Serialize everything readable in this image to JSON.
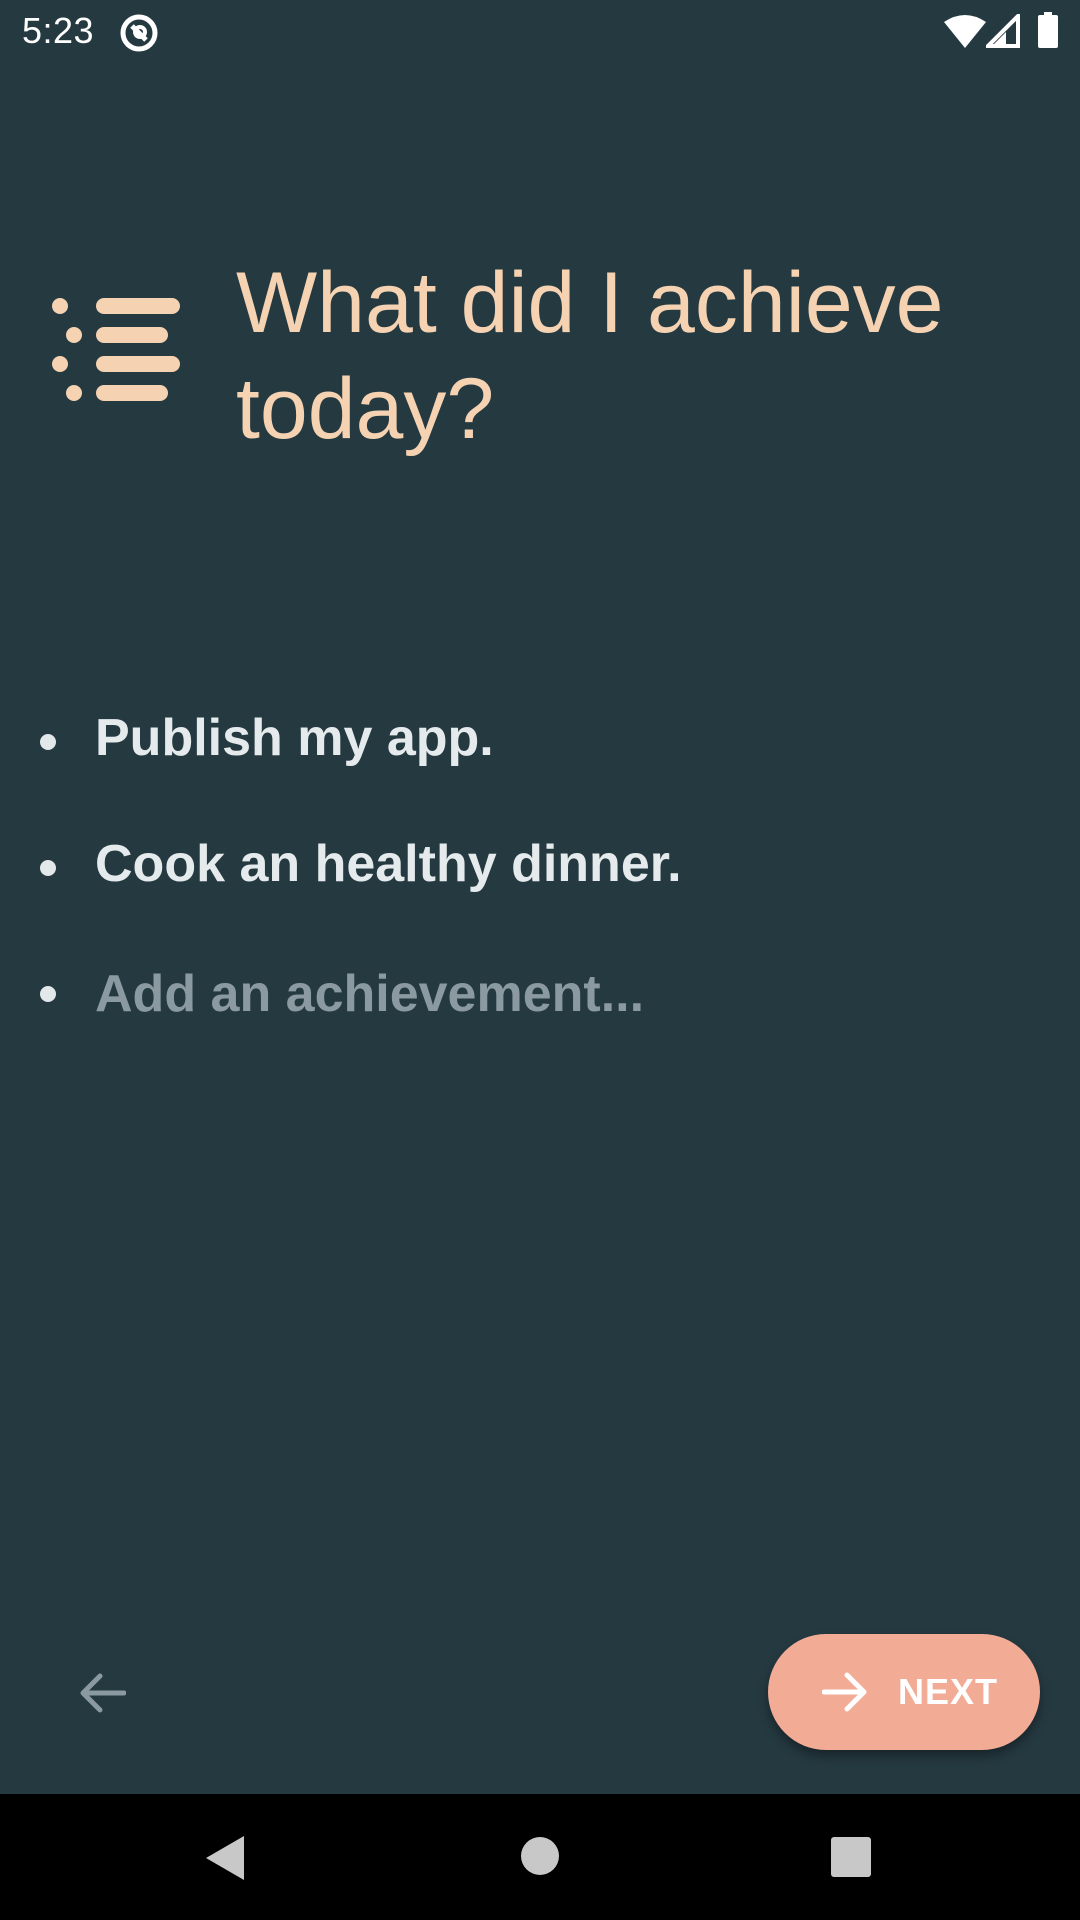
{
  "status_bar": {
    "time": "5:23",
    "icons": [
      "app-notification-icon",
      "wifi-icon",
      "cell-signal-icon",
      "battery-icon"
    ]
  },
  "header": {
    "icon": "list-icon",
    "title": "What did I achieve today?"
  },
  "achievements": {
    "items": [
      {
        "text": "Publish my app."
      },
      {
        "text": "Cook an healthy dinner."
      }
    ],
    "input_placeholder": "Add an achievement..."
  },
  "footer": {
    "back_icon": "arrow-left-icon",
    "next_label": "NEXT",
    "next_icon": "arrow-right-icon"
  },
  "nav_bar": {
    "icons": [
      "nav-back-icon",
      "nav-home-icon",
      "nav-recents-icon"
    ]
  },
  "colors": {
    "background": "#253941",
    "title": "#f5d2b1",
    "text": "#e5eaec",
    "placeholder": "#8a9aa0",
    "accent_button": "#f2ab95"
  }
}
